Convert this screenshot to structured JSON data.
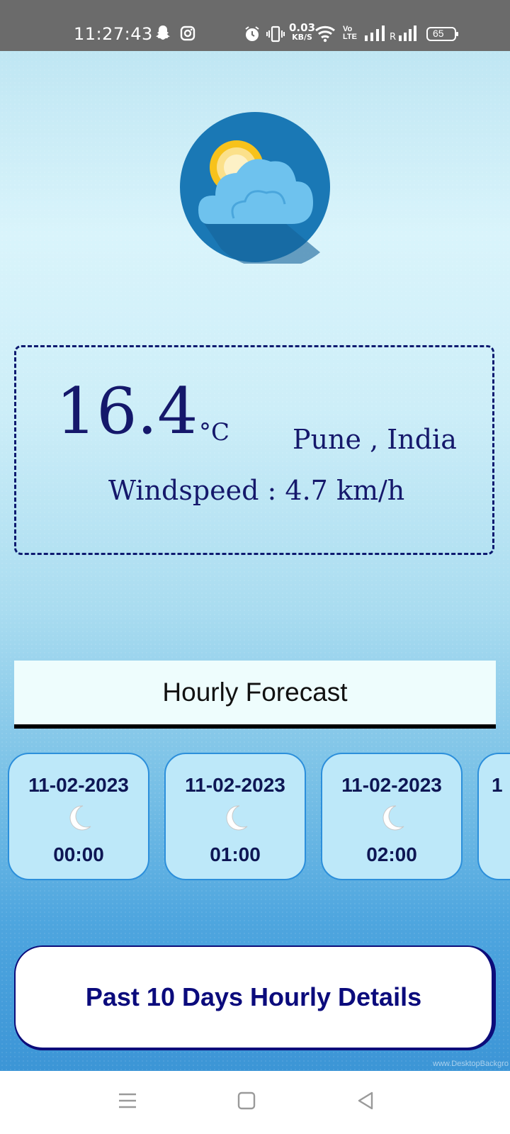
{
  "status_bar": {
    "time": "11:27:43",
    "net_speed_value": "0.03",
    "net_speed_unit": "KB/S",
    "volte": "Vo LTE",
    "battery": "65",
    "icons": [
      "snapchat-icon",
      "instagram-icon",
      "alarm-icon",
      "vibrate-icon",
      "wifi-icon",
      "volte-icon",
      "signal-icon",
      "roaming-signal-icon",
      "battery-icon"
    ]
  },
  "weather": {
    "temperature": "16.4",
    "unit": "°C",
    "location": "Pune , India",
    "windspeed": "Windspeed : 4.7 km/h",
    "logo_icon": "partly-cloudy-icon"
  },
  "forecast": {
    "header": "Hourly Forecast",
    "cards": [
      {
        "date": "11-02-2023",
        "time": "00:00",
        "icon": "moon-icon"
      },
      {
        "date": "11-02-2023",
        "time": "01:00",
        "icon": "moon-icon"
      },
      {
        "date": "11-02-2023",
        "time": "02:00",
        "icon": "moon-icon"
      },
      {
        "date": "1",
        "time": "",
        "icon": "moon-icon"
      }
    ]
  },
  "past_button_label": "Past 10 Days Hourly Details",
  "watermark": "www.DesktopBackgro",
  "nav": {
    "icons": [
      "menu-icon",
      "home-square-icon",
      "back-triangle-icon"
    ]
  },
  "colors": {
    "accent": "#15186b",
    "card_bg": "#bde8f9",
    "card_border": "#2c8fdb",
    "button_text": "#0b0b7c"
  }
}
